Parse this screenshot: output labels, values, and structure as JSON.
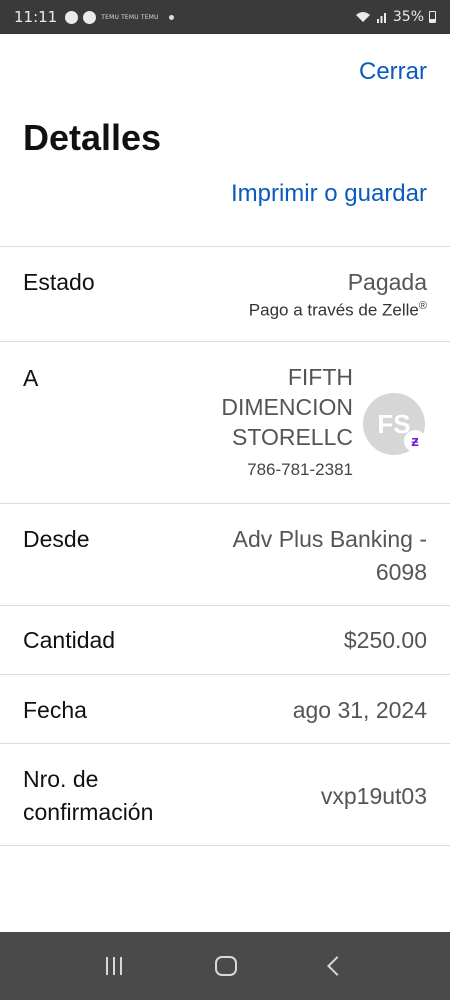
{
  "status_bar": {
    "time": "11:11",
    "temu_labels": [
      "TEMU",
      "TEMU",
      "TEMU"
    ],
    "battery": "35%"
  },
  "header": {
    "close_label": "Cerrar",
    "title": "Detalles",
    "print_label": "Imprimir o guardar"
  },
  "details": {
    "status": {
      "label": "Estado",
      "value": "Pagada",
      "sub_prefix": "Pago a través de Zelle",
      "sub_mark": "®"
    },
    "to": {
      "label": "A",
      "name_lines": [
        "FIFTH",
        "DIMENCION",
        "STORELLC"
      ],
      "phone": "786-781-2381",
      "avatar_initials": "FS",
      "badge_icon": "zelle-icon"
    },
    "from": {
      "label": "Desde",
      "value_line1": "Adv Plus Banking -",
      "value_line2": "6098"
    },
    "amount": {
      "label": "Cantidad",
      "value": "$250.00"
    },
    "date": {
      "label": "Fecha",
      "value": "ago 31, 2024"
    },
    "confirmation": {
      "label_line1": "Nro. de",
      "label_line2": "confirmación",
      "value": "vxp19ut03"
    }
  },
  "colors": {
    "link": "#0b5bbd",
    "zelle": "#6d1ed4"
  }
}
